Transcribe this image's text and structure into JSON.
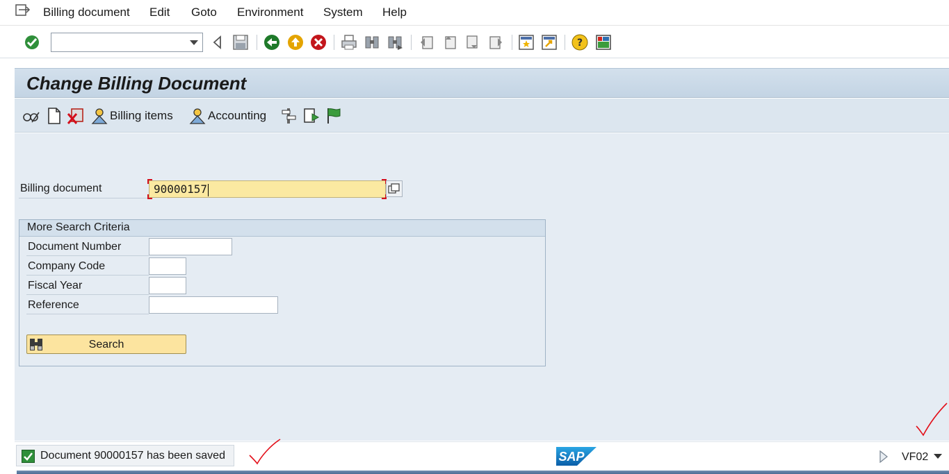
{
  "menu": {
    "items": [
      "Billing document",
      "Edit",
      "Goto",
      "Environment",
      "System",
      "Help"
    ]
  },
  "toolbar": {
    "command_value": "",
    "icons": [
      "enter-icon",
      "back-icon",
      "exit-icon",
      "cancel-icon",
      "print-icon",
      "find-icon",
      "find-next-icon",
      "first-page-icon",
      "previous-page-icon",
      "next-page-icon",
      "last-page-icon",
      "new-session-icon",
      "shortcut-icon",
      "help-icon",
      "layout-icon"
    ]
  },
  "title": "Change Billing Document",
  "app_toolbar": {
    "billing_items_label": "Billing items",
    "accounting_label": "Accounting"
  },
  "form": {
    "billing_document_label": "Billing document",
    "billing_document_value": "90000157"
  },
  "search_criteria": {
    "title": "More Search Criteria",
    "document_number_label": "Document Number",
    "company_code_label": "Company Code",
    "fiscal_year_label": "Fiscal Year",
    "reference_label": "Reference",
    "search_label": "Search"
  },
  "status": {
    "message": "Document 90000157 has been saved",
    "transaction_code": "VF02",
    "logo_text": "SAP"
  },
  "colors": {
    "title_bg": "#c3d4e4",
    "content_bg": "#e5ecf3",
    "input_highlight": "#fbe9a1",
    "button_yellow": "#fce49f",
    "annotation_red": "#e3101a"
  }
}
